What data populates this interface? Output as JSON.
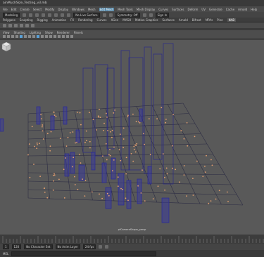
{
  "window": {
    "title": "ainMuchSize_Testing_v3.mb"
  },
  "menubar": {
    "items": [
      "File",
      "Edit",
      "Create",
      "Select",
      "Modify",
      "Display",
      "Windows",
      "Mesh",
      "Edit Mesh",
      "Mesh Tools",
      "Mesh Display",
      "Curves",
      "Surfaces",
      "Deform",
      "UV",
      "Generate",
      "Cache",
      "Arnold",
      "Help"
    ],
    "active_index": 8
  },
  "statusline": {
    "mode": "Modeling",
    "live_surface": "No Live Surface",
    "symmetry": "Symmetry: Off",
    "sign_in": "Sign In"
  },
  "shelf": {
    "tabs": [
      "Polygons",
      "Sculpting",
      "Rigging",
      "Animation",
      "FX",
      "Rendering",
      "Curves",
      "XGen",
      "MASH",
      "Motion Graphics",
      "Surfaces",
      "Arnold",
      "Bifrost",
      "MPAs",
      "Pine",
      "NAB"
    ],
    "active_tab_index": 15
  },
  "panel": {
    "menus": [
      "View",
      "Shading",
      "Lighting",
      "Show",
      "Renderer",
      "Panels"
    ]
  },
  "viewport": {
    "camera_label": "pfCameraShape_persp"
  },
  "timeline": {
    "range_start": "1",
    "range_end": "120",
    "character_set": "No Character Set",
    "anim_layer": "No Anim Layer",
    "fps": "24 fps"
  },
  "cmdline": {
    "mode": "MEL"
  }
}
